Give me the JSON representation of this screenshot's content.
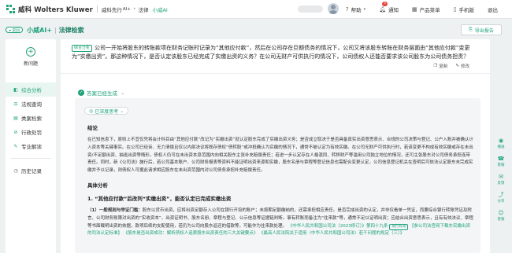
{
  "brand": {
    "name": "威科 Wolters Kluwer",
    "product": "威科先行",
    "product_suffix": "AI+",
    "section": "法律",
    "assistant": "小威AI",
    "accent": "#1fa27a"
  },
  "topnav": {
    "help": "帮助",
    "notify": "通知",
    "notify_count": "5",
    "products": "产品菜单",
    "mobile": "手机版",
    "logout": "退出"
  },
  "subheader": {
    "back": "◂ 返回",
    "title": "小威AI+",
    "divider": "|",
    "subtitle": "法律检索",
    "export": "导出报告"
  },
  "sidebar": {
    "new_question": "新问题",
    "items": [
      {
        "label": "综合分析",
        "icon": "analysis-icon"
      },
      {
        "label": "法规查询",
        "icon": "law-icon"
      },
      {
        "label": "类案检索",
        "icon": "case-icon"
      },
      {
        "label": "行政处罚",
        "icon": "penalty-icon"
      },
      {
        "label": "专业解读",
        "icon": "interpret-icon"
      }
    ],
    "history": "历史记录"
  },
  "question": {
    "tag": "综合分析",
    "text": "公司一开始将股东的转账款项在财务记账时记录为“其他应付款”，然后在公司存在巨额债务的情况下，公司又将该股东转账在财务层面由“其他应付款”变更为“实缴出资”。那这种情况下，是否认定该股东已经完成了实缴出资的义务？在公司无财产可供执行的情况下，公司债权人还能否要求该公司股东为公司债务担责？",
    "copy": "复制",
    "edit": "修改"
  },
  "answer": {
    "status": "答案已经生成",
    "thinking": "已深度思考",
    "conclusion_heading": "结论",
    "conclusion": "在已知信息下，原则上不宜仅凭将会计科目由“其他应付款”改记为“实缴出资”就认定股东完成了实缴出资义务；是否成立取决于是否具备真实出资意思表示、合规的公司决策与登记、公户入账并被确认计入资本等关键事实。在公司已经诉、无力清偿且仅以内部决议将既存债权“债转股”或冲抵确认为实缴的情况下，通常不被认定为有效实缴。在公司无财产可供执行时，若该变更不构成有效实缴或存在未出资/不足额出资、抽逃出资等情形，债权人仍可在未出资本息范围内向相关股东主张补充赔偿责任；若进一步认定存在人格混同、转移财产等滥用公司独立地位的情况，还可主张股东对公司债务承担连带责任。同时，新《公司法》施行后，若公司基本账户、公司财务报表等资料不能证明出资来源和实缴，股东名册与章程等登记信息也需配合变更认定，公司信息登记机关在查明后可依法认定股东未完成实缴并予以记录，则债权人可据此请求相应股东在未出资范围内对公司债务承担补充赔偿责任。",
    "detail_heading": "具体分析",
    "sub_heading": "1. “其他应付款”后改列“实缴出资”，能否认定已完成实缴出资",
    "para_label": "（1）一般规则与举证门槛：",
    "para_text": "股东以货币出资，应将出资足额存入公司在银行开设的账户；未按期足额缴纳的，还需承担相应责任。是否完成出资的认定，并非仅看单一凭证，而要综合银行转账凭证及附言、公司财务账簿对出资的“实收资本”、出资证明书、股东名册、章程与登记、公示信息等证据链判断。事有转账而备注为“往来款”等，通常不足以证明出资；应结合出资意思表示，且有有效决议、章程等书面载明出资的依据，款项后续的支配使用，若仍为公司向股东返还的借款等，可能作为往来款处理。",
    "cite1": "《中华人民共和国公司法（2023修订）》第四十九条",
    "law_tag": "现行有效",
    "cite2": "【参公司法官网下载东实缴出资的司法认定标准】",
    "cite3": "《股东是否出资成功：解析债权人追索股东出资责任的三大关键要点》",
    "cite4": "《最高人民法院关于适用〈中华人民共和国公司法〉若干问题的规定（三）》"
  },
  "rail": [
    {
      "label": "播送",
      "icon": "broadcast-icon"
    },
    {
      "label": "客服",
      "icon": "service-icon"
    },
    {
      "label": "反馈",
      "icon": "feedback-icon"
    },
    {
      "label": "分享",
      "icon": "share-icon"
    },
    {
      "label": "客服",
      "icon": "chat-icon"
    }
  ]
}
